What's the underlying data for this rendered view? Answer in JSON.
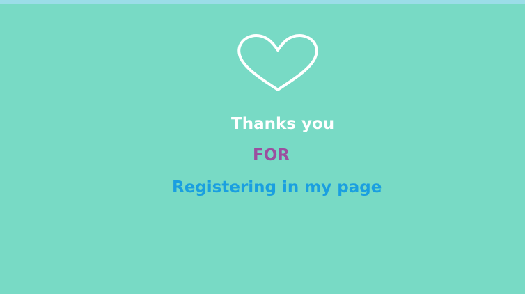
{
  "colors": {
    "background": "#78dac5",
    "top_strip": "#9bdde8",
    "heart_stroke": "#ffffff",
    "thanks_text": "#ffffff",
    "for_text": "#9b4f9f",
    "registering_text": "#1a9fe0"
  },
  "icon": {
    "name": "heart-icon"
  },
  "message": {
    "line1": "Thanks you",
    "line2": "FOR",
    "line3": "Registering in my page"
  }
}
